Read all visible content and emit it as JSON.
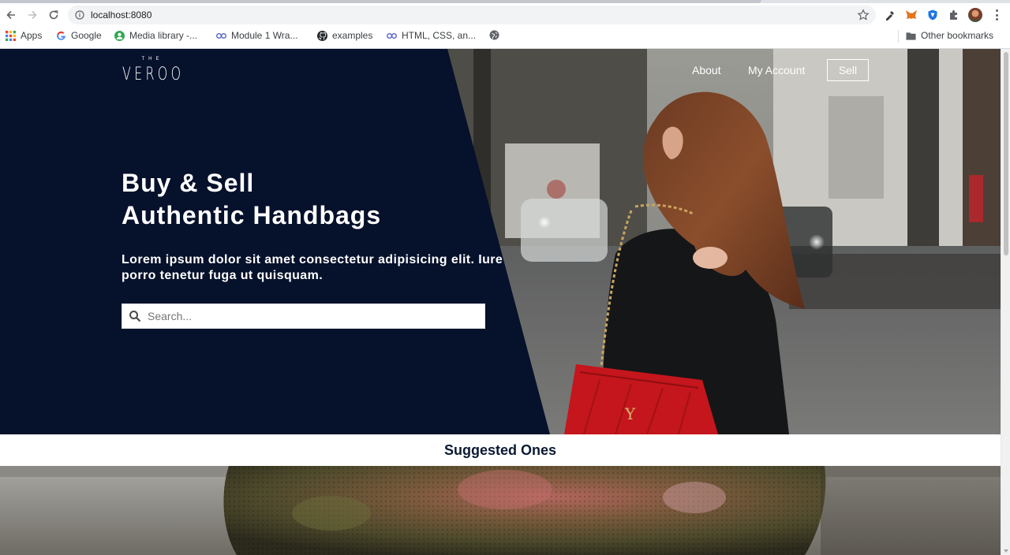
{
  "browser": {
    "url": "localhost:8080",
    "bookmarks": [
      {
        "label": "Apps",
        "icon": "apps-grid-icon"
      },
      {
        "label": "Google",
        "icon": "google-icon"
      },
      {
        "label": "Media library -...",
        "icon": "media-library-icon"
      },
      {
        "label": "Module 1 Wra...",
        "icon": "link-icon"
      },
      {
        "label": "examples",
        "icon": "github-icon"
      },
      {
        "label": "HTML, CSS, an...",
        "icon": "link-icon"
      },
      {
        "label": "",
        "icon": "globe-icon"
      }
    ],
    "other_bookmarks": "Other bookmarks"
  },
  "site": {
    "logo_top": "THE",
    "logo_word": "VEROO",
    "nav": {
      "about": "About",
      "account": "My Account",
      "sell": "Sell"
    },
    "hero": {
      "headline_line1": "Buy & Sell",
      "headline_line2": "Authentic Handbags",
      "tagline": "Lorem ipsum dolor sit amet consectetur adipisicing elit. Iure porro tenetur fuga ut quisquam.",
      "search_placeholder": "Search..."
    },
    "section_title": "Suggested Ones"
  },
  "colors": {
    "panel": "#06112b",
    "accent_bag": "#c4161c"
  }
}
